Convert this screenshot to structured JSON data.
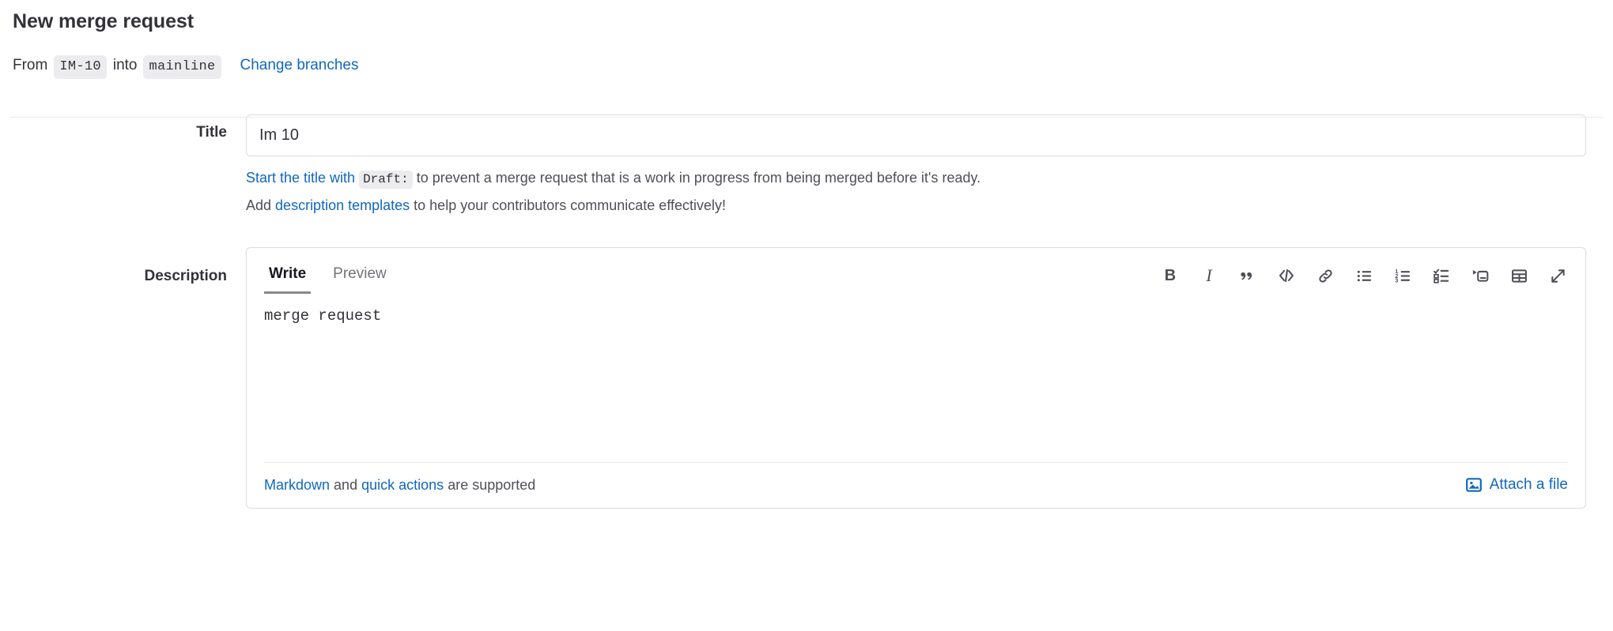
{
  "header": {
    "title": "New merge request",
    "from_label": "From",
    "source_branch": "IM-10",
    "into_label": "into",
    "target_branch": "mainline",
    "change_branches_link": "Change branches"
  },
  "title_field": {
    "label": "Title",
    "value": "Im 10",
    "placeholder": "",
    "hint1_link": "Start the title with",
    "hint1_code": "Draft:",
    "hint1_rest": "to prevent a merge request that is a work in progress from being merged before it's ready.",
    "hint2_prefix": "Add",
    "hint2_link": "description templates",
    "hint2_rest": "to help your contributors communicate effectively!"
  },
  "description_field": {
    "label": "Description",
    "tabs": [
      {
        "label": "Write",
        "active": true
      },
      {
        "label": "Preview",
        "active": false
      }
    ],
    "toolbar": [
      {
        "name": "bold-icon",
        "label": "Add bold text",
        "glyph": "B"
      },
      {
        "name": "italic-icon",
        "label": "Add italic text",
        "glyph": "I"
      },
      {
        "name": "quote-icon",
        "label": "Insert a quote",
        "glyph": "”"
      },
      {
        "name": "code-icon",
        "label": "Insert code",
        "glyph": "</>"
      },
      {
        "name": "link-icon",
        "label": "Add a link",
        "glyph": ""
      },
      {
        "name": "bulleted-list-icon",
        "label": "Add a bullet list",
        "glyph": ""
      },
      {
        "name": "numbered-list-icon",
        "label": "Add a numbered list",
        "glyph": ""
      },
      {
        "name": "task-list-icon",
        "label": "Add a checklist",
        "glyph": ""
      },
      {
        "name": "collapsible-section-icon",
        "label": "Add a collapsible section",
        "glyph": ""
      },
      {
        "name": "table-icon",
        "label": "Add a table",
        "glyph": ""
      },
      {
        "name": "fullscreen-icon",
        "label": "Go full screen",
        "glyph": ""
      }
    ],
    "body_text": "merge request",
    "body_placeholder": "",
    "footer": {
      "markdown_link": "Markdown",
      "and_text": "and",
      "quick_actions_link": "quick actions",
      "supported_text": "are supported",
      "attach_label": "Attach a file"
    }
  },
  "colors": {
    "link": "#1068bf",
    "text": "#333238",
    "muted": "#4f4f57",
    "border": "#dcdcde",
    "chip_bg": "#ececef"
  }
}
